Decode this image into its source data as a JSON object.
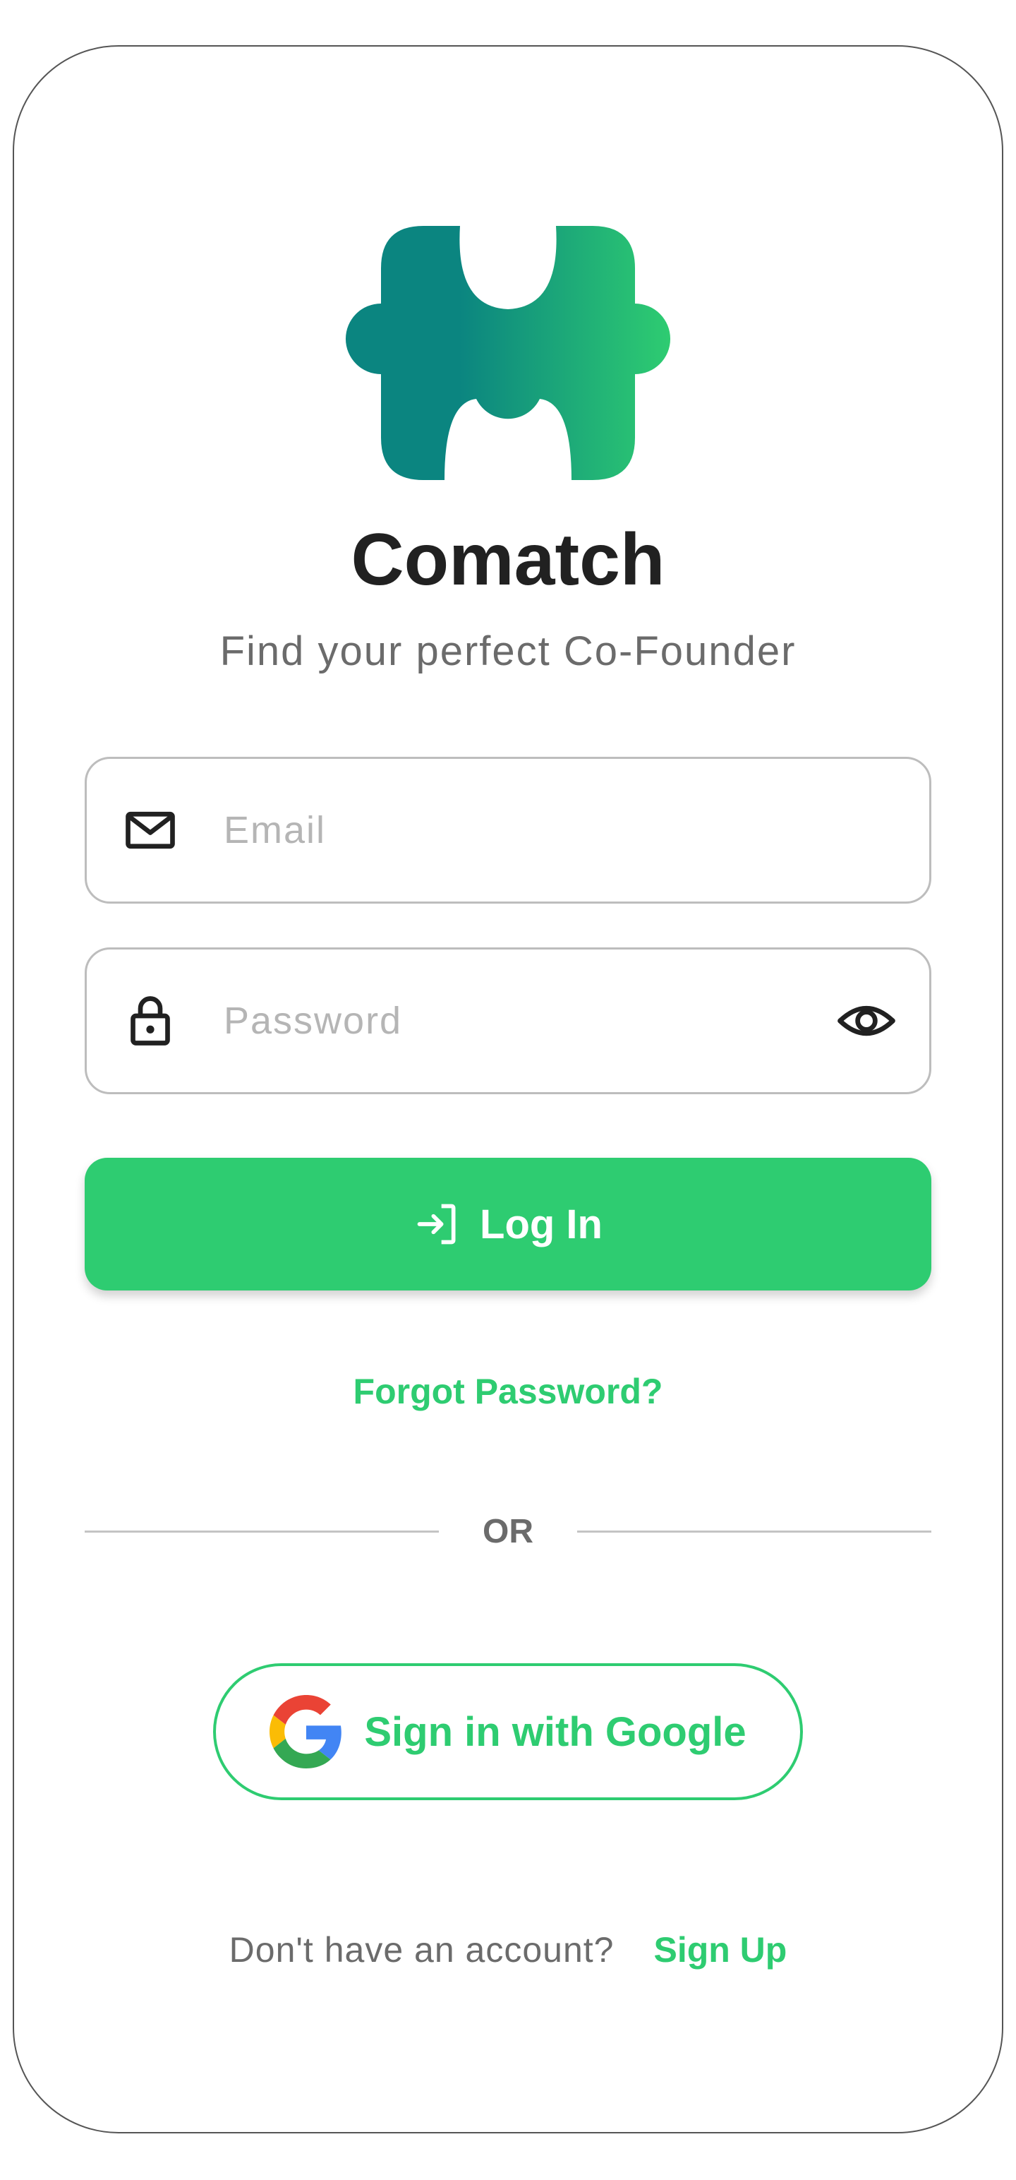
{
  "brand": {
    "name": "Comatch",
    "tagline": "Find your perfect Co-Founder",
    "gradient_start": "#0b8580",
    "gradient_end": "#2ecc71"
  },
  "form": {
    "email": {
      "value": "",
      "placeholder": "Email",
      "icon": "mail-icon"
    },
    "password": {
      "value": "",
      "placeholder": "Password",
      "icon": "lock-icon",
      "toggle_icon": "eye-icon"
    }
  },
  "actions": {
    "login_label": "Log In",
    "login_icon": "login-arrow-icon",
    "forgot_label": "Forgot Password?",
    "divider_label": "OR",
    "google_label": "Sign in with Google",
    "google_icon": "google-icon"
  },
  "footer": {
    "prompt": "Don't have an account?",
    "signup_label": "Sign Up"
  },
  "colors": {
    "accent": "#2ecc71",
    "text_dark": "#212121",
    "text_muted": "#6b6b6b",
    "border": "#bdbdbd"
  }
}
